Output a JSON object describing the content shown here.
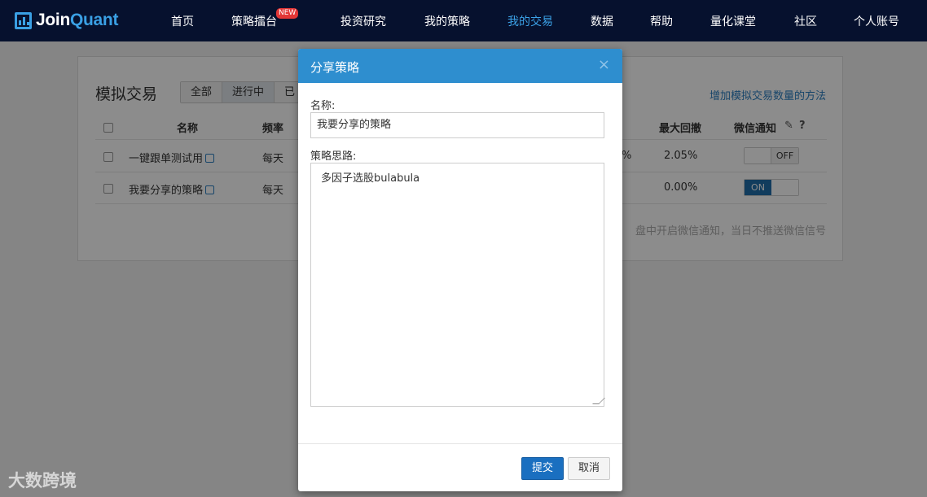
{
  "nav": {
    "logo_join": "Join",
    "logo_quant": "Quant",
    "items": [
      {
        "label": "首页"
      },
      {
        "label": "策略擂台"
      },
      {
        "label": "投资研究"
      },
      {
        "label": "我的策略"
      },
      {
        "label": "我的交易"
      },
      {
        "label": "数据"
      },
      {
        "label": "帮助"
      },
      {
        "label": "量化课堂"
      },
      {
        "label": "社区"
      },
      {
        "label": "个人账号"
      }
    ],
    "new_badge": "NEW",
    "active_item": "我的交易"
  },
  "panel": {
    "title": "模拟交易",
    "filters": [
      "全部",
      "进行中",
      "已"
    ],
    "active_filter": "进行中",
    "help_link": "增加模拟交易数量的方法",
    "columns": [
      "名称",
      "频率",
      "最大回撤",
      "微信通知"
    ],
    "rows": [
      {
        "name": "一键跟单测试用",
        "freq": "每天",
        "partial": "%",
        "drawdown": "2.05%",
        "wechat": "OFF"
      },
      {
        "name": "我要分享的策略",
        "freq": "每天",
        "partial": "",
        "drawdown": "0.00%",
        "wechat": "ON"
      }
    ],
    "note": "盘中开启微信通知，当日不推送微信信号"
  },
  "modal": {
    "title": "分享策略",
    "close": "×",
    "name_label": "名称:",
    "name_value": "我要分享的策略",
    "idea_label": "策略思路:",
    "idea_value": "多因子选股bulabula",
    "submit": "提交",
    "cancel": "取消"
  },
  "watermark": "大数跨境",
  "colors": {
    "nav_bg": "#06112e",
    "accent": "#3aa0e4",
    "modal_header": "#2e8ecf",
    "primary_button": "#1a6fc0"
  }
}
